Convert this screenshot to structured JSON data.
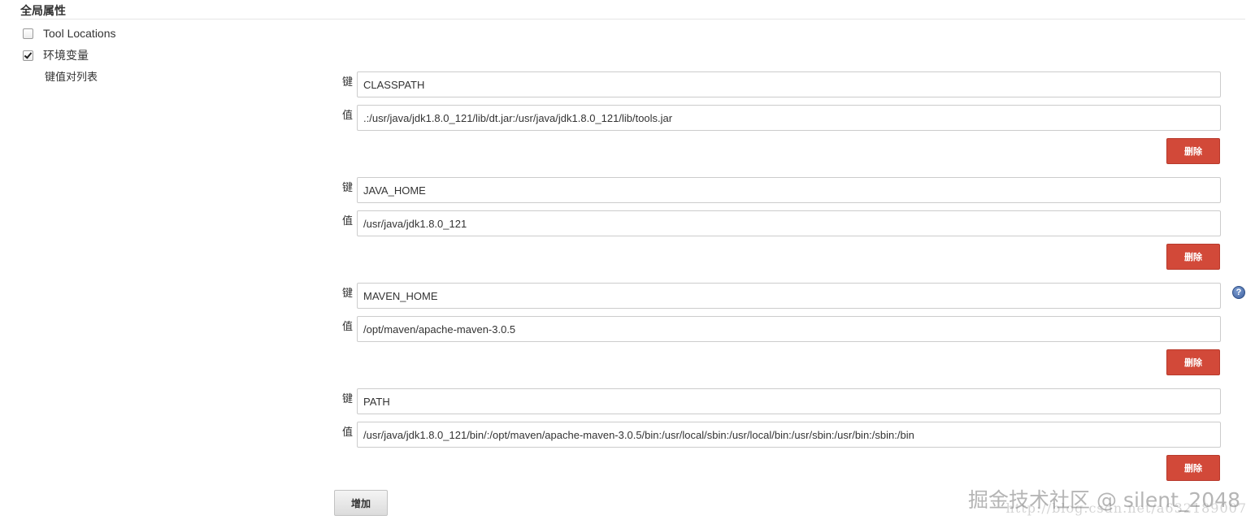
{
  "section": {
    "title": "全局属性"
  },
  "options": [
    {
      "label": "Tool Locations",
      "checked": false
    },
    {
      "label": "环境变量",
      "checked": true
    }
  ],
  "kv_list_label": "键值对列表",
  "key_label": "键",
  "value_label": "值",
  "entries": [
    {
      "key": "CLASSPATH",
      "value": ".:/usr/java/jdk1.8.0_121/lib/dt.jar:/usr/java/jdk1.8.0_121/lib/tools.jar"
    },
    {
      "key": "JAVA_HOME",
      "value": "/usr/java/jdk1.8.0_121"
    },
    {
      "key": "MAVEN_HOME",
      "value": "/opt/maven/apache-maven-3.0.5"
    },
    {
      "key": "PATH",
      "value": "/usr/java/jdk1.8.0_121/bin/:/opt/maven/apache-maven-3.0.5/bin:/usr/local/sbin:/usr/local/bin:/usr/sbin:/usr/bin:/sbin:/bin"
    }
  ],
  "delete_label": "删除",
  "add_label": "增加",
  "help_glyph": "?",
  "watermark": {
    "main": "掘金技术社区 @ silent_2048",
    "sub": "http://blog.csdn.net/a632189007"
  },
  "colors": {
    "delete_button": "#d24939",
    "help_icon": "#3c5f9e"
  }
}
